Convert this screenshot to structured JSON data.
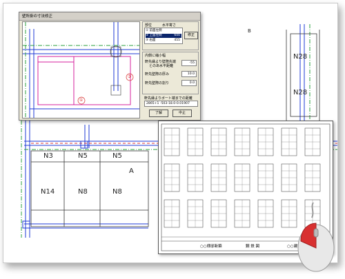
{
  "dialog": {
    "title": "壁所掛の寸法修正",
    "list_headers": [
      "部位",
      "水平寄さ"
    ],
    "list_rows": [
      {
        "label": "① 前面左側",
        "value": "",
        "selected": false
      },
      {
        "label": "② 上面左側",
        "value": "600",
        "selected": true
      },
      {
        "label": "③ 右面",
        "value": "455",
        "selected": false
      }
    ],
    "correct_button": "修正",
    "group_label": "内側に縮小幅",
    "row1_label": "軒先縁より壁際先端",
    "row1_label2": "とのあ水平距離",
    "row1_value": "-55",
    "row2_label": "軒先壁際の厚み",
    "row2_value": "10.0",
    "row3_label": "軒先壁際の割り",
    "row3_value": "0.0",
    "support_label": "軒先縁よりボート端までの距離",
    "formula": "2865+1 -503-18.0-0.01907",
    "ok_button": "了解",
    "cancel_button": "中止",
    "marker_1": "①",
    "marker_3": "③"
  },
  "plan": {
    "rooms": [
      "N3",
      "N5",
      "N5",
      "N14",
      "N8",
      "N8"
    ],
    "label_a": "A",
    "label_b": "B",
    "side_labels": [
      "N28",
      "N28"
    ]
  },
  "cad_sheet": {
    "footer_left": "○○様邸新築",
    "footer_mid": "鋼 鉄 図",
    "footer_right": "○○建設 株式"
  },
  "colors": {
    "accent_blue": "#1c39d6",
    "accent_magenta": "#d6209c",
    "accent_red": "#d83030",
    "accent_green": "#2ea040",
    "selection": "#0a246a"
  },
  "mouse_icon": "computer-mouse-icon"
}
